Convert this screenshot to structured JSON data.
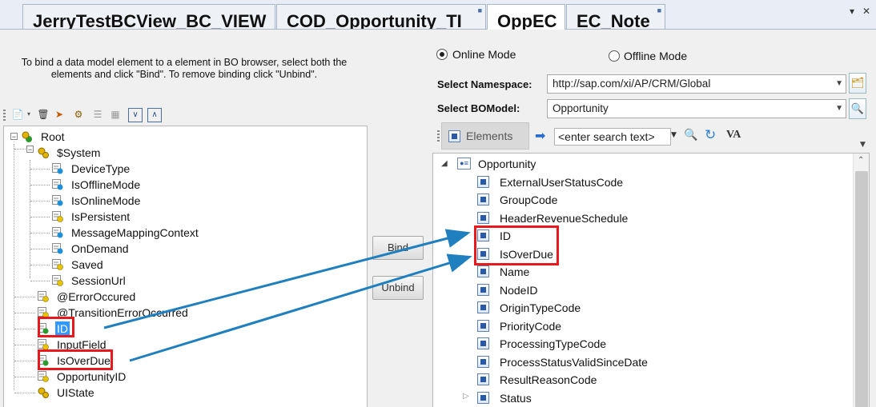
{
  "tabs": [
    {
      "label": "JerryTestBCView_BC_VIEW",
      "active": false,
      "locked": false
    },
    {
      "label": "COD_Opportunity_TI",
      "active": false,
      "locked": true
    },
    {
      "label": "OppEC",
      "active": true,
      "locked": false
    },
    {
      "label": "EC_Note",
      "active": false,
      "locked": true
    }
  ],
  "window_controls": {
    "dropdown": "▾",
    "close": "✕"
  },
  "instructions": "To bind a data model element to a element in BO browser, select both the elements and click \"Bind\". To remove binding click \"Unbind\".",
  "data_model_tree": [
    {
      "label": "Root",
      "level": 0,
      "icon": "root-node-icon",
      "expander": "minus"
    },
    {
      "label": "$System",
      "level": 1,
      "icon": "structure-node-icon",
      "expander": "minus"
    },
    {
      "label": "DeviceType",
      "level": 2,
      "icon": "field-blue-icon"
    },
    {
      "label": "IsOfflineMode",
      "level": 2,
      "icon": "field-blue-icon"
    },
    {
      "label": "IsOnlineMode",
      "level": 2,
      "icon": "field-blue-icon"
    },
    {
      "label": "IsPersistent",
      "level": 2,
      "icon": "field-yellow-icon"
    },
    {
      "label": "MessageMappingContext",
      "level": 2,
      "icon": "field-blue-icon"
    },
    {
      "label": "OnDemand",
      "level": 2,
      "icon": "field-blue-icon"
    },
    {
      "label": "Saved",
      "level": 2,
      "icon": "field-yellow-icon"
    },
    {
      "label": "SessionUrl",
      "level": 2,
      "icon": "field-yellow-icon"
    },
    {
      "label": "@ErrorOccured",
      "level": 1,
      "icon": "field-yellow-icon"
    },
    {
      "label": "@TransitionErrorOccurred",
      "level": 1,
      "icon": "field-yellow-icon"
    },
    {
      "label": "ID",
      "level": 1,
      "icon": "field-green-icon",
      "selected": true,
      "highlighted": true
    },
    {
      "label": "InputField",
      "level": 1,
      "icon": "field-yellow-icon"
    },
    {
      "label": "IsOverDue",
      "level": 1,
      "icon": "field-green-icon",
      "highlighted": true
    },
    {
      "label": "OpportunityID",
      "level": 1,
      "icon": "field-yellow-icon"
    },
    {
      "label": "UIState",
      "level": 1,
      "icon": "structure-node-icon"
    }
  ],
  "buttons": {
    "bind": "Bind",
    "unbind": "Unbind"
  },
  "mode": {
    "online": "Online Mode",
    "offline": "Offline Mode",
    "selected": "online"
  },
  "namespace": {
    "label": "Select Namespace:",
    "value": "http://sap.com/xi/AP/CRM/Global"
  },
  "bomodel": {
    "label": "Select BOModel:",
    "value": "Opportunity"
  },
  "elements_toolbar": {
    "elements_label": "Elements",
    "search_placeholder": "<enter search text>",
    "va_label": "VA"
  },
  "bo_tree": {
    "root": "Opportunity",
    "items": [
      {
        "label": "ExternalUserStatusCode"
      },
      {
        "label": "GroupCode"
      },
      {
        "label": "HeaderRevenueSchedule"
      },
      {
        "label": "ID",
        "highlighted": true
      },
      {
        "label": "IsOverDue",
        "highlighted": true
      },
      {
        "label": "Name"
      },
      {
        "label": "NodeID"
      },
      {
        "label": "OriginTypeCode"
      },
      {
        "label": "PriorityCode"
      },
      {
        "label": "ProcessingTypeCode"
      },
      {
        "label": "ProcessStatusValidSinceDate"
      },
      {
        "label": "ResultReasonCode"
      },
      {
        "label": "Status",
        "expandable": true
      }
    ]
  },
  "colors": {
    "highlight": "#e8191c",
    "arrow": "#1f7fbf",
    "selection": "#3399ff",
    "tab_strip": "#e9eef6"
  }
}
